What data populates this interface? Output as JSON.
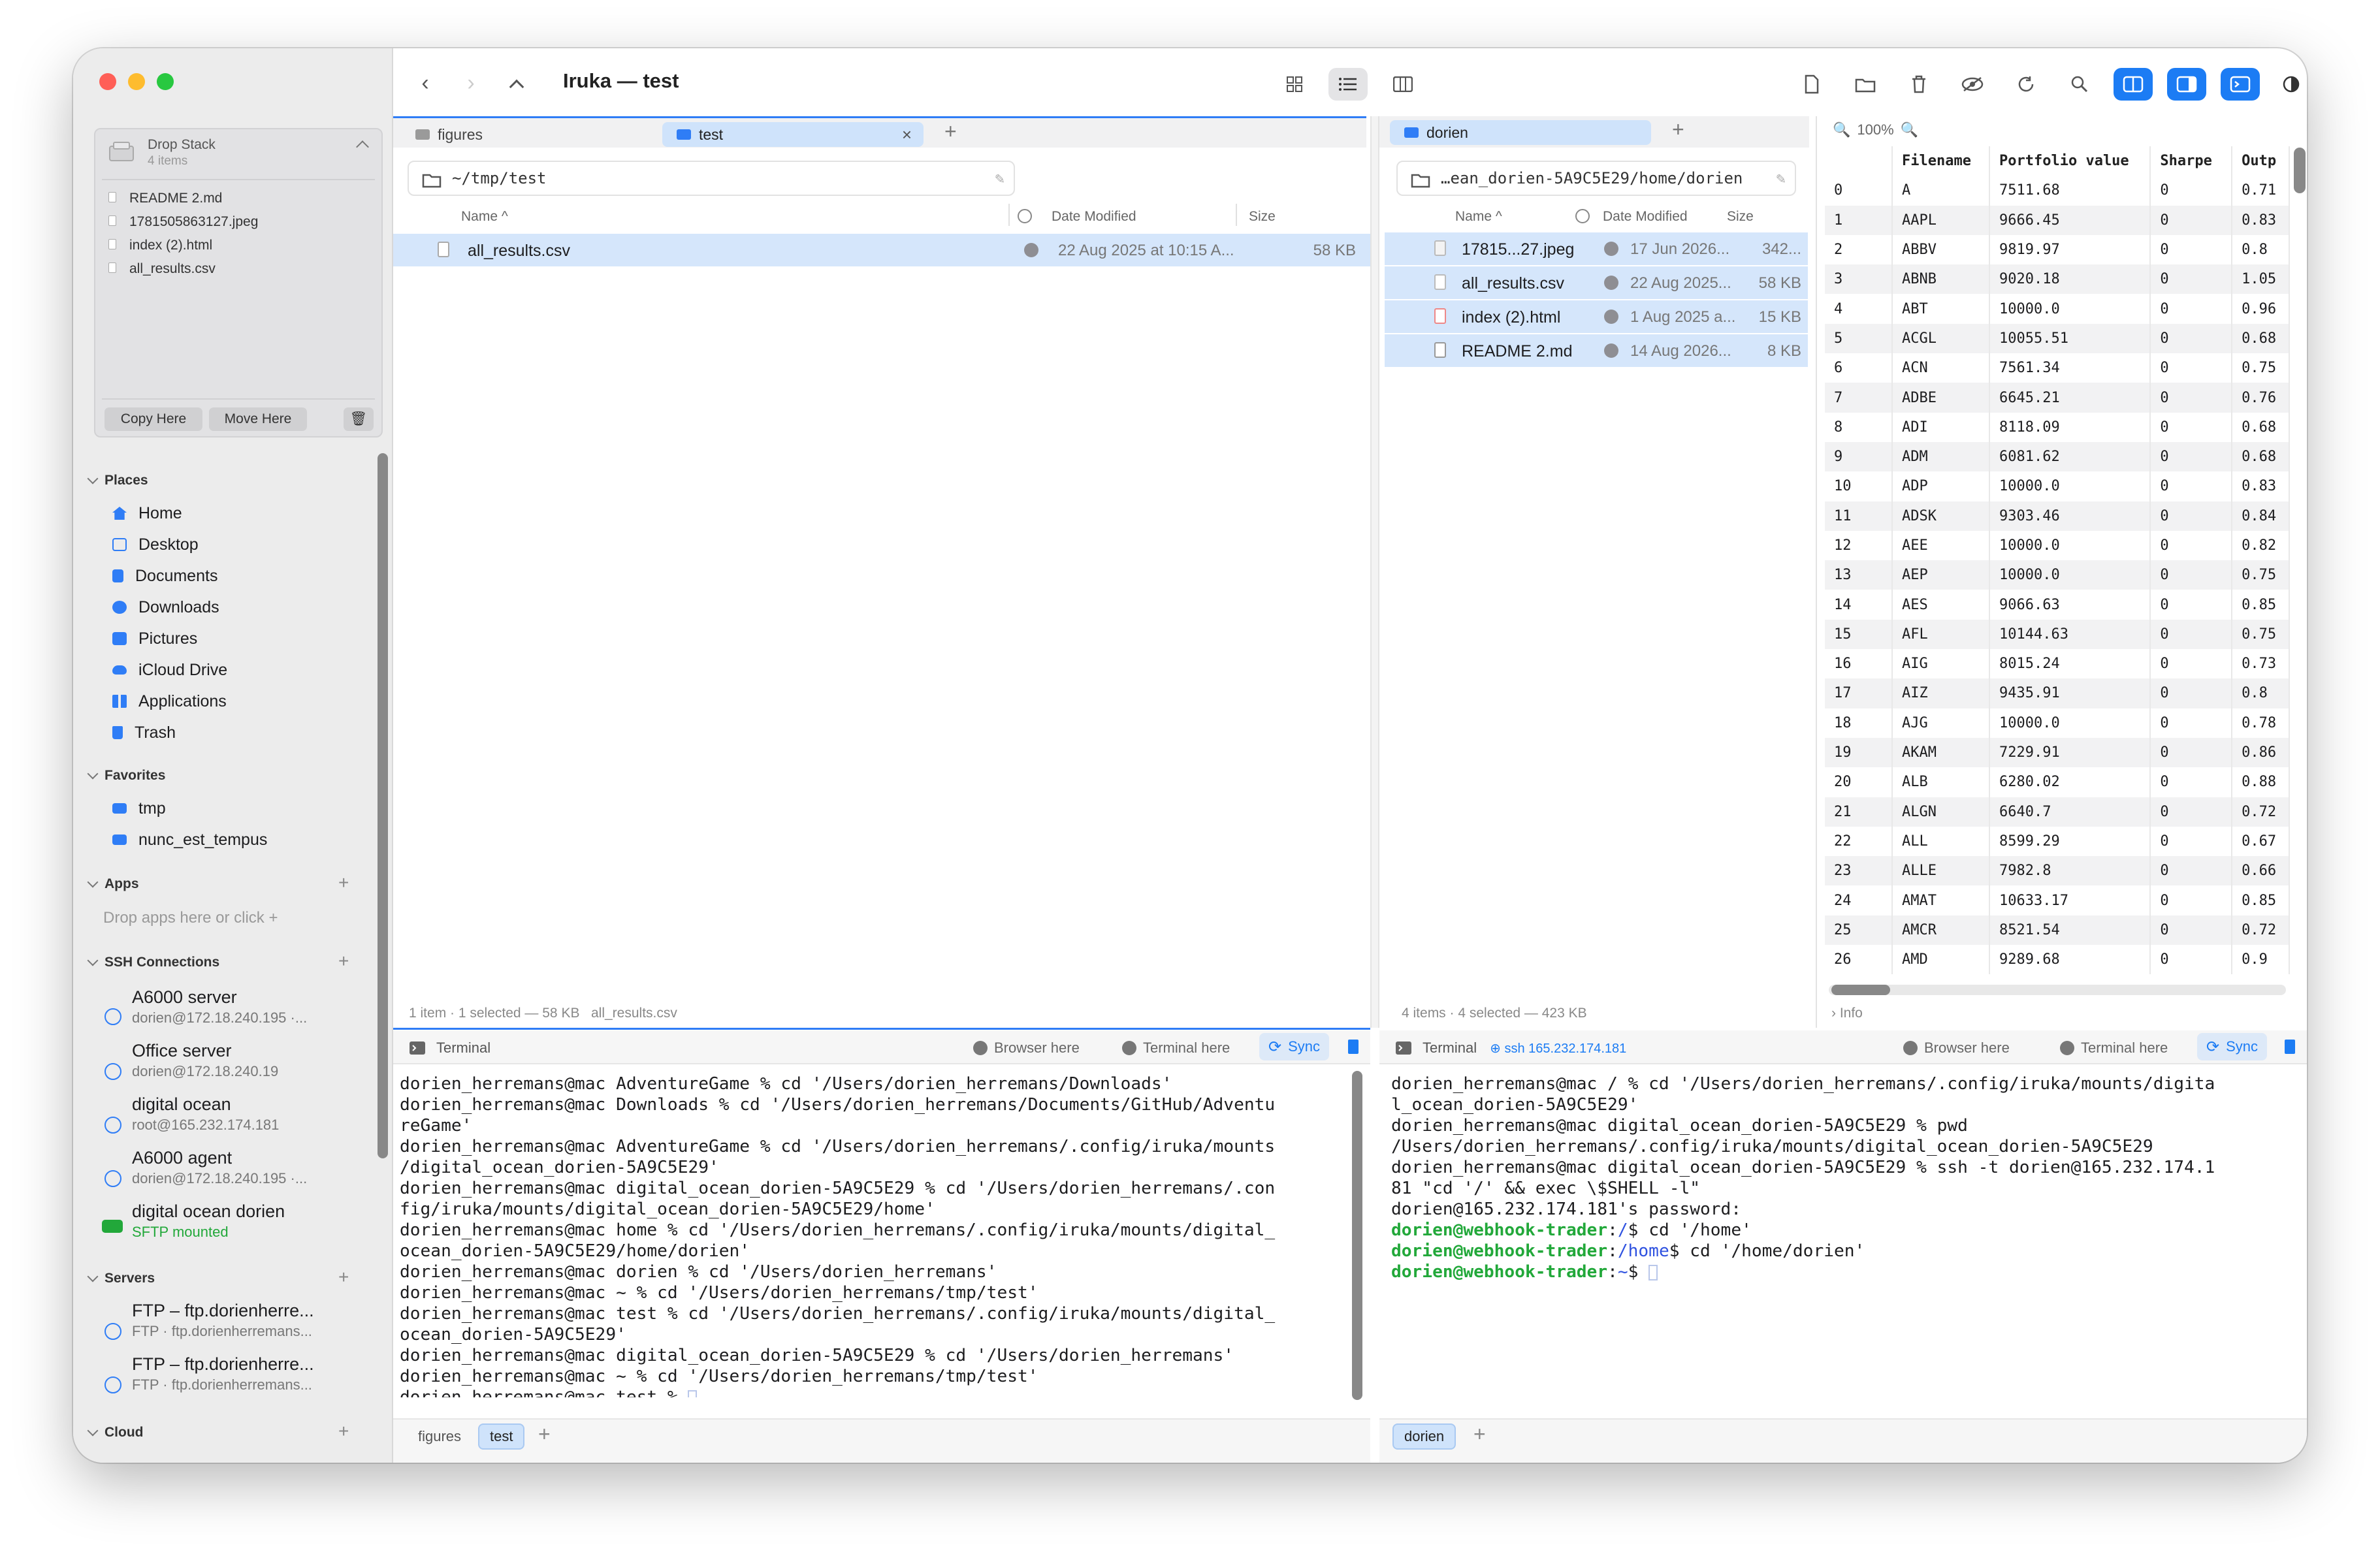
{
  "window": {
    "title": "Iruka — test"
  },
  "drop_stack": {
    "title": "Drop Stack",
    "count": "4 items",
    "files": [
      "README 2.md",
      "1781505863127.jpeg",
      "index (2).html",
      "all_results.csv"
    ],
    "copy_label": "Copy Here",
    "move_label": "Move Here"
  },
  "sidebar": {
    "places_title": "Places",
    "places": [
      "Home",
      "Desktop",
      "Documents",
      "Downloads",
      "Pictures",
      "iCloud Drive",
      "Applications",
      "Trash"
    ],
    "favorites_title": "Favorites",
    "favorites": [
      "tmp",
      "nunc_est_tempus"
    ],
    "apps_title": "Apps",
    "apps_hint": "Drop apps here or click +",
    "ssh_title": "SSH Connections",
    "ssh": [
      {
        "name": "A6000 server",
        "sub": "dorien@172.18.240.195 ·..."
      },
      {
        "name": "Office server",
        "sub": "dorien@172.18.240.19"
      },
      {
        "name": "digital ocean",
        "sub": "root@165.232.174.181"
      },
      {
        "name": "A6000 agent",
        "sub": "dorien@172.18.240.195 ·..."
      },
      {
        "name": "digital ocean dorien",
        "sub": "SFTP mounted"
      }
    ],
    "servers_title": "Servers",
    "servers": [
      {
        "name": "FTP – ftp.dorienherre...",
        "sub": "FTP · ftp.dorienherremans..."
      },
      {
        "name": "FTP – ftp.dorienherre...",
        "sub": "FTP · ftp.dorienherremans..."
      }
    ],
    "cloud_title": "Cloud"
  },
  "left_pane": {
    "tabs": [
      "figures",
      "test"
    ],
    "path": "~/tmp/test",
    "columns": {
      "name": "Name",
      "date": "Date Modified",
      "size": "Size"
    },
    "files": [
      {
        "name": "all_results.csv",
        "date": "22 Aug 2025 at 10:15 A...",
        "size": "58 KB"
      }
    ],
    "status": "1 item · 1 selected — 58 KB",
    "status_file": "all_results.csv"
  },
  "right_pane": {
    "tabs": [
      "dorien"
    ],
    "path": "…ean_dorien-5A9C5E29/home/dorien",
    "columns": {
      "name": "Name",
      "date": "Date Modified",
      "size": "Size"
    },
    "files": [
      {
        "name": "17815...27.jpeg",
        "date": "17 Jun 2026...",
        "size": "342..."
      },
      {
        "name": "all_results.csv",
        "date": "22 Aug 2025...",
        "size": "58 KB"
      },
      {
        "name": "index (2).html",
        "date": "1 Aug 2025 a...",
        "size": "15 KB"
      },
      {
        "name": "README 2.md",
        "date": "14 Aug 2026...",
        "size": "8 KB"
      }
    ],
    "status": "4 items · 4 selected — 423 KB"
  },
  "preview": {
    "zoom": "100%",
    "headers": [
      "",
      "Filename",
      "Portfolio value",
      "Sharpe",
      "Outp"
    ],
    "rows": [
      [
        "0",
        "A",
        "7511.68",
        "0",
        "0.71"
      ],
      [
        "1",
        "AAPL",
        "9666.45",
        "0",
        "0.83"
      ],
      [
        "2",
        "ABBV",
        "9819.97",
        "0",
        "0.8"
      ],
      [
        "3",
        "ABNB",
        "9020.18",
        "0",
        "1.05"
      ],
      [
        "4",
        "ABT",
        "10000.0",
        "0",
        "0.96"
      ],
      [
        "5",
        "ACGL",
        "10055.51",
        "0",
        "0.68"
      ],
      [
        "6",
        "ACN",
        "7561.34",
        "0",
        "0.75"
      ],
      [
        "7",
        "ADBE",
        "6645.21",
        "0",
        "0.76"
      ],
      [
        "8",
        "ADI",
        "8118.09",
        "0",
        "0.68"
      ],
      [
        "9",
        "ADM",
        "6081.62",
        "0",
        "0.68"
      ],
      [
        "10",
        "ADP",
        "10000.0",
        "0",
        "0.83"
      ],
      [
        "11",
        "ADSK",
        "9303.46",
        "0",
        "0.84"
      ],
      [
        "12",
        "AEE",
        "10000.0",
        "0",
        "0.82"
      ],
      [
        "13",
        "AEP",
        "10000.0",
        "0",
        "0.75"
      ],
      [
        "14",
        "AES",
        "9066.63",
        "0",
        "0.85"
      ],
      [
        "15",
        "AFL",
        "10144.63",
        "0",
        "0.75"
      ],
      [
        "16",
        "AIG",
        "8015.24",
        "0",
        "0.73"
      ],
      [
        "17",
        "AIZ",
        "9435.91",
        "0",
        "0.8"
      ],
      [
        "18",
        "AJG",
        "10000.0",
        "0",
        "0.78"
      ],
      [
        "19",
        "AKAM",
        "7229.91",
        "0",
        "0.86"
      ],
      [
        "20",
        "ALB",
        "6280.02",
        "0",
        "0.88"
      ],
      [
        "21",
        "ALGN",
        "6640.7",
        "0",
        "0.72"
      ],
      [
        "22",
        "ALL",
        "8599.29",
        "0",
        "0.67"
      ],
      [
        "23",
        "ALLE",
        "7982.8",
        "0",
        "0.66"
      ],
      [
        "24",
        "AMAT",
        "10633.17",
        "0",
        "0.85"
      ],
      [
        "25",
        "AMCR",
        "8521.54",
        "0",
        "0.72"
      ],
      [
        "26",
        "AMD",
        "9289.68",
        "0",
        "0.9"
      ]
    ],
    "info_label": "Info"
  },
  "terminal_left": {
    "title": "Terminal",
    "browser_here": "Browser here",
    "terminal_here": "Terminal here",
    "sync": "Sync",
    "lines": [
      "dorien_herremans@mac AdventureGame % cd '/Users/dorien_herremans/Downloads'",
      "dorien_herremans@mac Downloads % cd '/Users/dorien_herremans/Documents/GitHub/Adventu",
      "reGame'",
      "dorien_herremans@mac AdventureGame % cd '/Users/dorien_herremans/.config/iruka/mounts",
      "/digital_ocean_dorien-5A9C5E29'",
      "dorien_herremans@mac digital_ocean_dorien-5A9C5E29 % cd '/Users/dorien_herremans/.con",
      "fig/iruka/mounts/digital_ocean_dorien-5A9C5E29/home'",
      "dorien_herremans@mac home % cd '/Users/dorien_herremans/.config/iruka/mounts/digital_",
      "ocean_dorien-5A9C5E29/home/dorien'",
      "dorien_herremans@mac dorien % cd '/Users/dorien_herremans'",
      "dorien_herremans@mac ~ % cd '/Users/dorien_herremans/tmp/test'",
      "dorien_herremans@mac test % cd '/Users/dorien_herremans/.config/iruka/mounts/digital_",
      "ocean_dorien-5A9C5E29'",
      "dorien_herremans@mac digital_ocean_dorien-5A9C5E29 % cd '/Users/dorien_herremans'",
      "dorien_herremans@mac ~ % cd '/Users/dorien_herremans/tmp/test'",
      "dorien_herremans@mac test % "
    ],
    "tabs": [
      "figures",
      "test"
    ]
  },
  "terminal_right": {
    "title": "Terminal",
    "ssh_label": "ssh 165.232.174.181",
    "browser_here": "Browser here",
    "terminal_here": "Terminal here",
    "sync": "Sync",
    "lines": [
      "dorien_herremans@mac / % cd '/Users/dorien_herremans/.config/iruka/mounts/digita",
      "l_ocean_dorien-5A9C5E29'",
      "dorien_herremans@mac digital_ocean_dorien-5A9C5E29 % pwd",
      "/Users/dorien_herremans/.config/iruka/mounts/digital_ocean_dorien-5A9C5E29",
      "dorien_herremans@mac digital_ocean_dorien-5A9C5E29 % ssh -t dorien@165.232.174.1",
      "81 \"cd '/' && exec \\$SHELL -l\"",
      "dorien@165.232.174.181's password:"
    ],
    "prompt_user": "dorien@webhook-trader",
    "colored_lines": [
      {
        "path": "/",
        "cmd": "$ cd '/home'"
      },
      {
        "path": "/home",
        "cmd": "$ cd '/home/dorien'"
      },
      {
        "path": "~",
        "cmd": "$ "
      }
    ],
    "tabs": [
      "dorien"
    ]
  },
  "colors": {
    "accent": "#1c7cf4",
    "selection": "#d5e6fb",
    "prompt_green": "#22a83a",
    "prompt_path_blue": "#2f52e0"
  }
}
